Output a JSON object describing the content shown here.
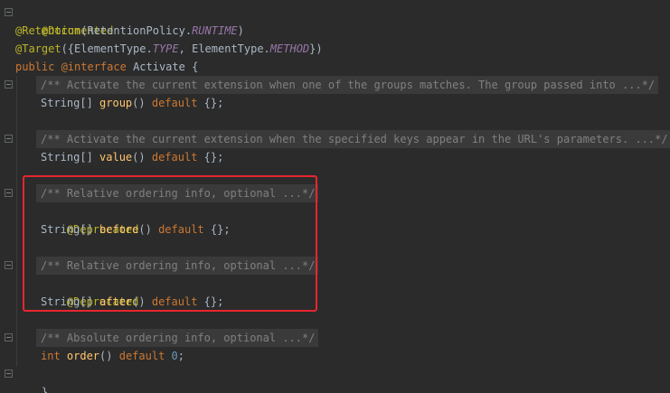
{
  "colors": {
    "background": "#2b2b2b",
    "text": "#a9b7c6",
    "annotation": "#bbb529",
    "keyword": "#cc7832",
    "method": "#ffc66d",
    "constant": "#9876aa",
    "comment": "#808080",
    "number": "#6897bb",
    "highlight_border": "#e8252f"
  },
  "code": {
    "ann_documented": "@Documented",
    "ann_retention": "@Retention",
    "retention_open": "(RetentionPolicy.",
    "runtime": "RUNTIME",
    "retention_close": ")",
    "ann_target": "@Target",
    "target_open": "({ElementType.",
    "type_const": "TYPE",
    "target_mid": ", ElementType.",
    "method_const": "METHOD",
    "target_close": "})",
    "kw_public": "public ",
    "kw_interface": "@interface ",
    "interface_name": "Activate {",
    "doc_group": "/** Activate the current extension when one of the groups matches. The group passed into ...*/",
    "string_array": "String[] ",
    "group_name": "group",
    "parens": "() ",
    "kw_default": "default",
    "empty_array": " {};",
    "doc_value": "/** Activate the current extension when the specified keys appear in the URL's parameters. ...*/",
    "value_name": "value",
    "doc_before": "/** Relative ordering info, optional ...*/",
    "ann_deprecated": "@Deprecated",
    "before_name": "before",
    "doc_after": "/** Relative ordering info, optional ...*/",
    "after_name": "after",
    "doc_order": "/** Absolute ordering info, optional ...*/",
    "kw_int": "int ",
    "order_name": "order",
    "zero_value": " 0",
    "semicolon": ";",
    "closing_brace": "}"
  }
}
